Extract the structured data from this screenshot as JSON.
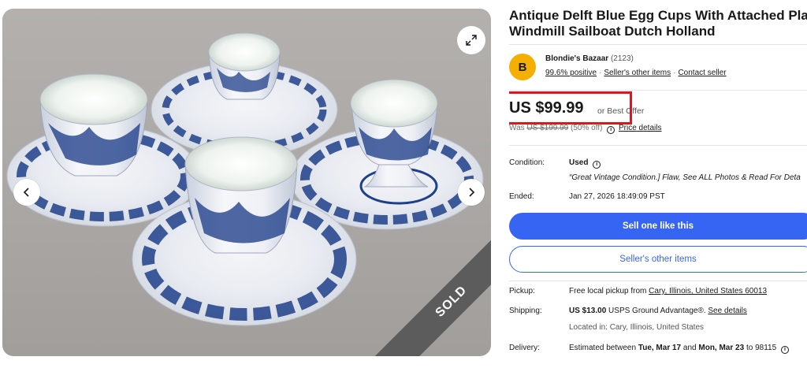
{
  "gallery": {
    "expand_icon": "expand-icon",
    "prev_icon": "chevron-left-icon",
    "next_icon": "chevron-right-icon",
    "sold_label": "SOLD",
    "porcelain_blue": "#1f3f8a",
    "porcelain_white": "#f3f4f6"
  },
  "listing": {
    "title_line1": "Antique Delft Blue Egg Cups With Attached Plate",
    "title_line2": "Windmill Sailboat Dutch Holland",
    "seller": {
      "avatar_letter": "B",
      "name": "Blondie's Bazaar",
      "feedback_count": "(2123)",
      "positive": "99.6% positive",
      "other_items_link": "Seller's other items",
      "contact_link": "Contact seller",
      "avatar_color": "#f5af02"
    },
    "price": "US $99.99",
    "best_offer": "or Best Offer",
    "was_prefix": "Was",
    "was_price": "US $199.99",
    "discount": "(50% off)",
    "price_details": "Price details",
    "highlight_color": "#e0161e"
  },
  "details": {
    "condition_label": "Condition:",
    "condition_value": "Used",
    "condition_note": "“Great Vintage Condition.] Flaw, See ALL Photos & Read For Deta",
    "ended_label": "Ended:",
    "ended_value": "Jan 27, 2026 18:49:09 PST"
  },
  "actions": {
    "sell_one": "Sell one like this",
    "sellers_items": "Seller's other items",
    "accent_color": "#3665f3"
  },
  "shipping": {
    "pickup_label": "Pickup:",
    "pickup_prefix": "Free local pickup from",
    "pickup_location": "Cary, Illinois, United States 60013",
    "shipping_label": "Shipping:",
    "shipping_price": "US $13.00",
    "shipping_service": "USPS Ground Advantage®.",
    "see_details": "See details",
    "located_in": "Located in: Cary, Illinois, United States",
    "delivery_label": "Delivery:",
    "delivery_prefix": "Estimated between",
    "delivery_start": "Tue, Mar 17",
    "delivery_and": "and",
    "delivery_end": "Mon, Mar 23",
    "delivery_suffix": "to 98115"
  }
}
